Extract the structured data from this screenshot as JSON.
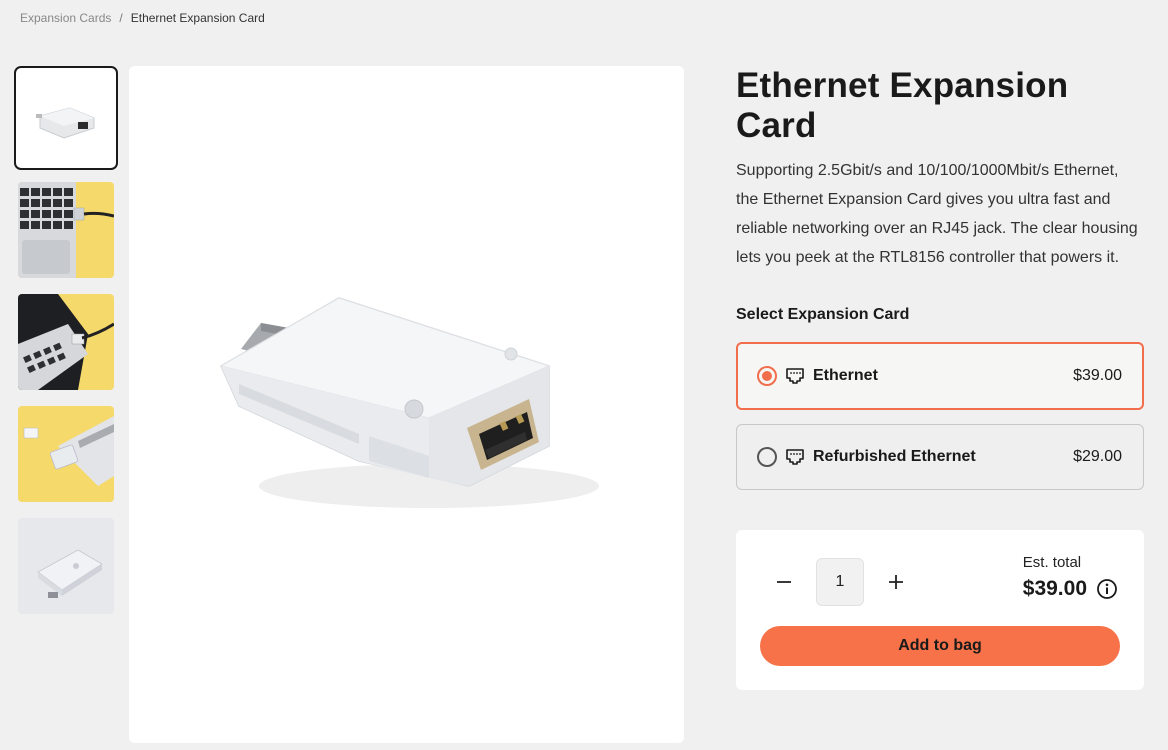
{
  "breadcrumb": {
    "parent": "Expansion Cards",
    "separator": "/",
    "current": "Ethernet Expansion Card"
  },
  "gallery": {
    "thumbnails": [
      {
        "name": "ethernet-card-front"
      },
      {
        "name": "laptop-keyboard-cable-yellow"
      },
      {
        "name": "laptop-cable-yellow-angled"
      },
      {
        "name": "card-inserting-yellow"
      },
      {
        "name": "card-clear-housing-back"
      }
    ],
    "active_index": 0
  },
  "product": {
    "title": "Ethernet Expansion Card",
    "description": "Supporting 2.5Gbit/s and 10/100/1000Mbit/s Ethernet, the Ethernet Expansion Card gives you ultra fast and reliable networking over an RJ45 jack. The clear housing lets you peek at the RTL8156 controller that powers it."
  },
  "selector": {
    "label": "Select Expansion Card",
    "options": [
      {
        "label": "Ethernet",
        "price": "$39.00",
        "icon": "ethernet-port-icon",
        "selected": true
      },
      {
        "label": "Refurbished Ethernet",
        "price": "$29.00",
        "icon": "ethernet-port-icon",
        "selected": false
      }
    ]
  },
  "cart": {
    "quantity": "1",
    "minus": "−",
    "plus": "+",
    "est_label": "Est. total",
    "est_price": "$39.00",
    "add_button": "Add to bag"
  },
  "colors": {
    "accent": "#f77248",
    "selected_border": "#f26d4b",
    "background": "#f0f0f0"
  }
}
